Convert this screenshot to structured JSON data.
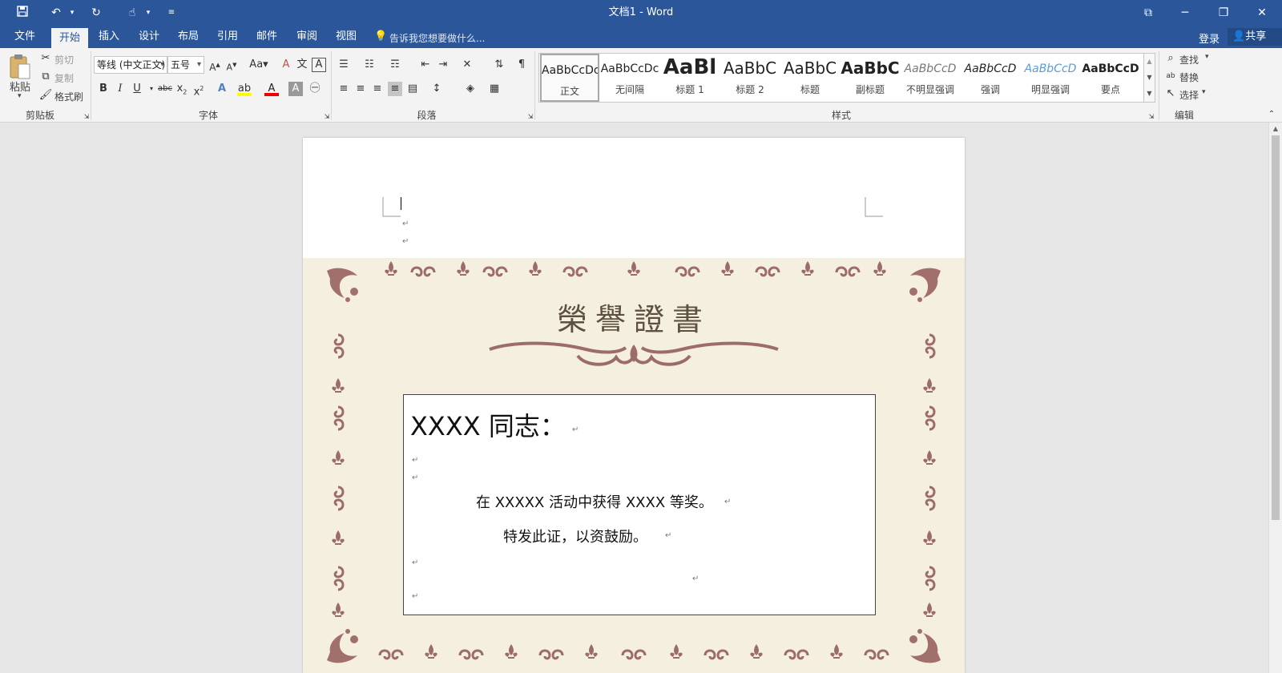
{
  "window": {
    "title": "文档1 - Word"
  },
  "tabs": [
    {
      "label": "文件"
    },
    {
      "label": "开始"
    },
    {
      "label": "插入"
    },
    {
      "label": "设计"
    },
    {
      "label": "布局"
    },
    {
      "label": "引用"
    },
    {
      "label": "邮件"
    },
    {
      "label": "审阅"
    },
    {
      "label": "视图"
    }
  ],
  "tell_me": "告诉我您想要做什么...",
  "account": {
    "login": "登录",
    "share": "共享"
  },
  "clipboard": {
    "paste": "粘贴",
    "cut": "剪切",
    "copy": "复制",
    "format_painter": "格式刷",
    "label": "剪贴板"
  },
  "font": {
    "name": "等线 (中文正文)",
    "size": "五号",
    "label": "字体"
  },
  "paragraph": {
    "label": "段落"
  },
  "styles": {
    "label": "样式",
    "items": [
      {
        "preview": "AaBbCcDc",
        "name": "正文"
      },
      {
        "preview": "AaBbCcDc",
        "name": "无间隔"
      },
      {
        "preview": "AaBl",
        "name": "标题 1"
      },
      {
        "preview": "AaBbC",
        "name": "标题 2"
      },
      {
        "preview": "AaBbC",
        "name": "标题"
      },
      {
        "preview": "AaBbC",
        "name": "副标题"
      },
      {
        "preview": "AaBbCcD",
        "name": "不明显强调"
      },
      {
        "preview": "AaBbCcD",
        "name": "强调"
      },
      {
        "preview": "AaBbCcD",
        "name": "明显强调"
      },
      {
        "preview": "AaBbCcD",
        "name": "要点"
      }
    ]
  },
  "editing": {
    "find": "查找",
    "replace": "替换",
    "select": "选择",
    "label": "编辑"
  },
  "certificate": {
    "heading": "榮譽證書",
    "salutation": "XXXX 同志：",
    "line1": "在 XXXXX 活动中获得 XXXX 等奖。",
    "line2": "特发此证，以资鼓励。"
  },
  "colors": {
    "accent": "#2b579a",
    "ornament": "#9c6b6b",
    "cert_bg": "#f5efe0"
  }
}
